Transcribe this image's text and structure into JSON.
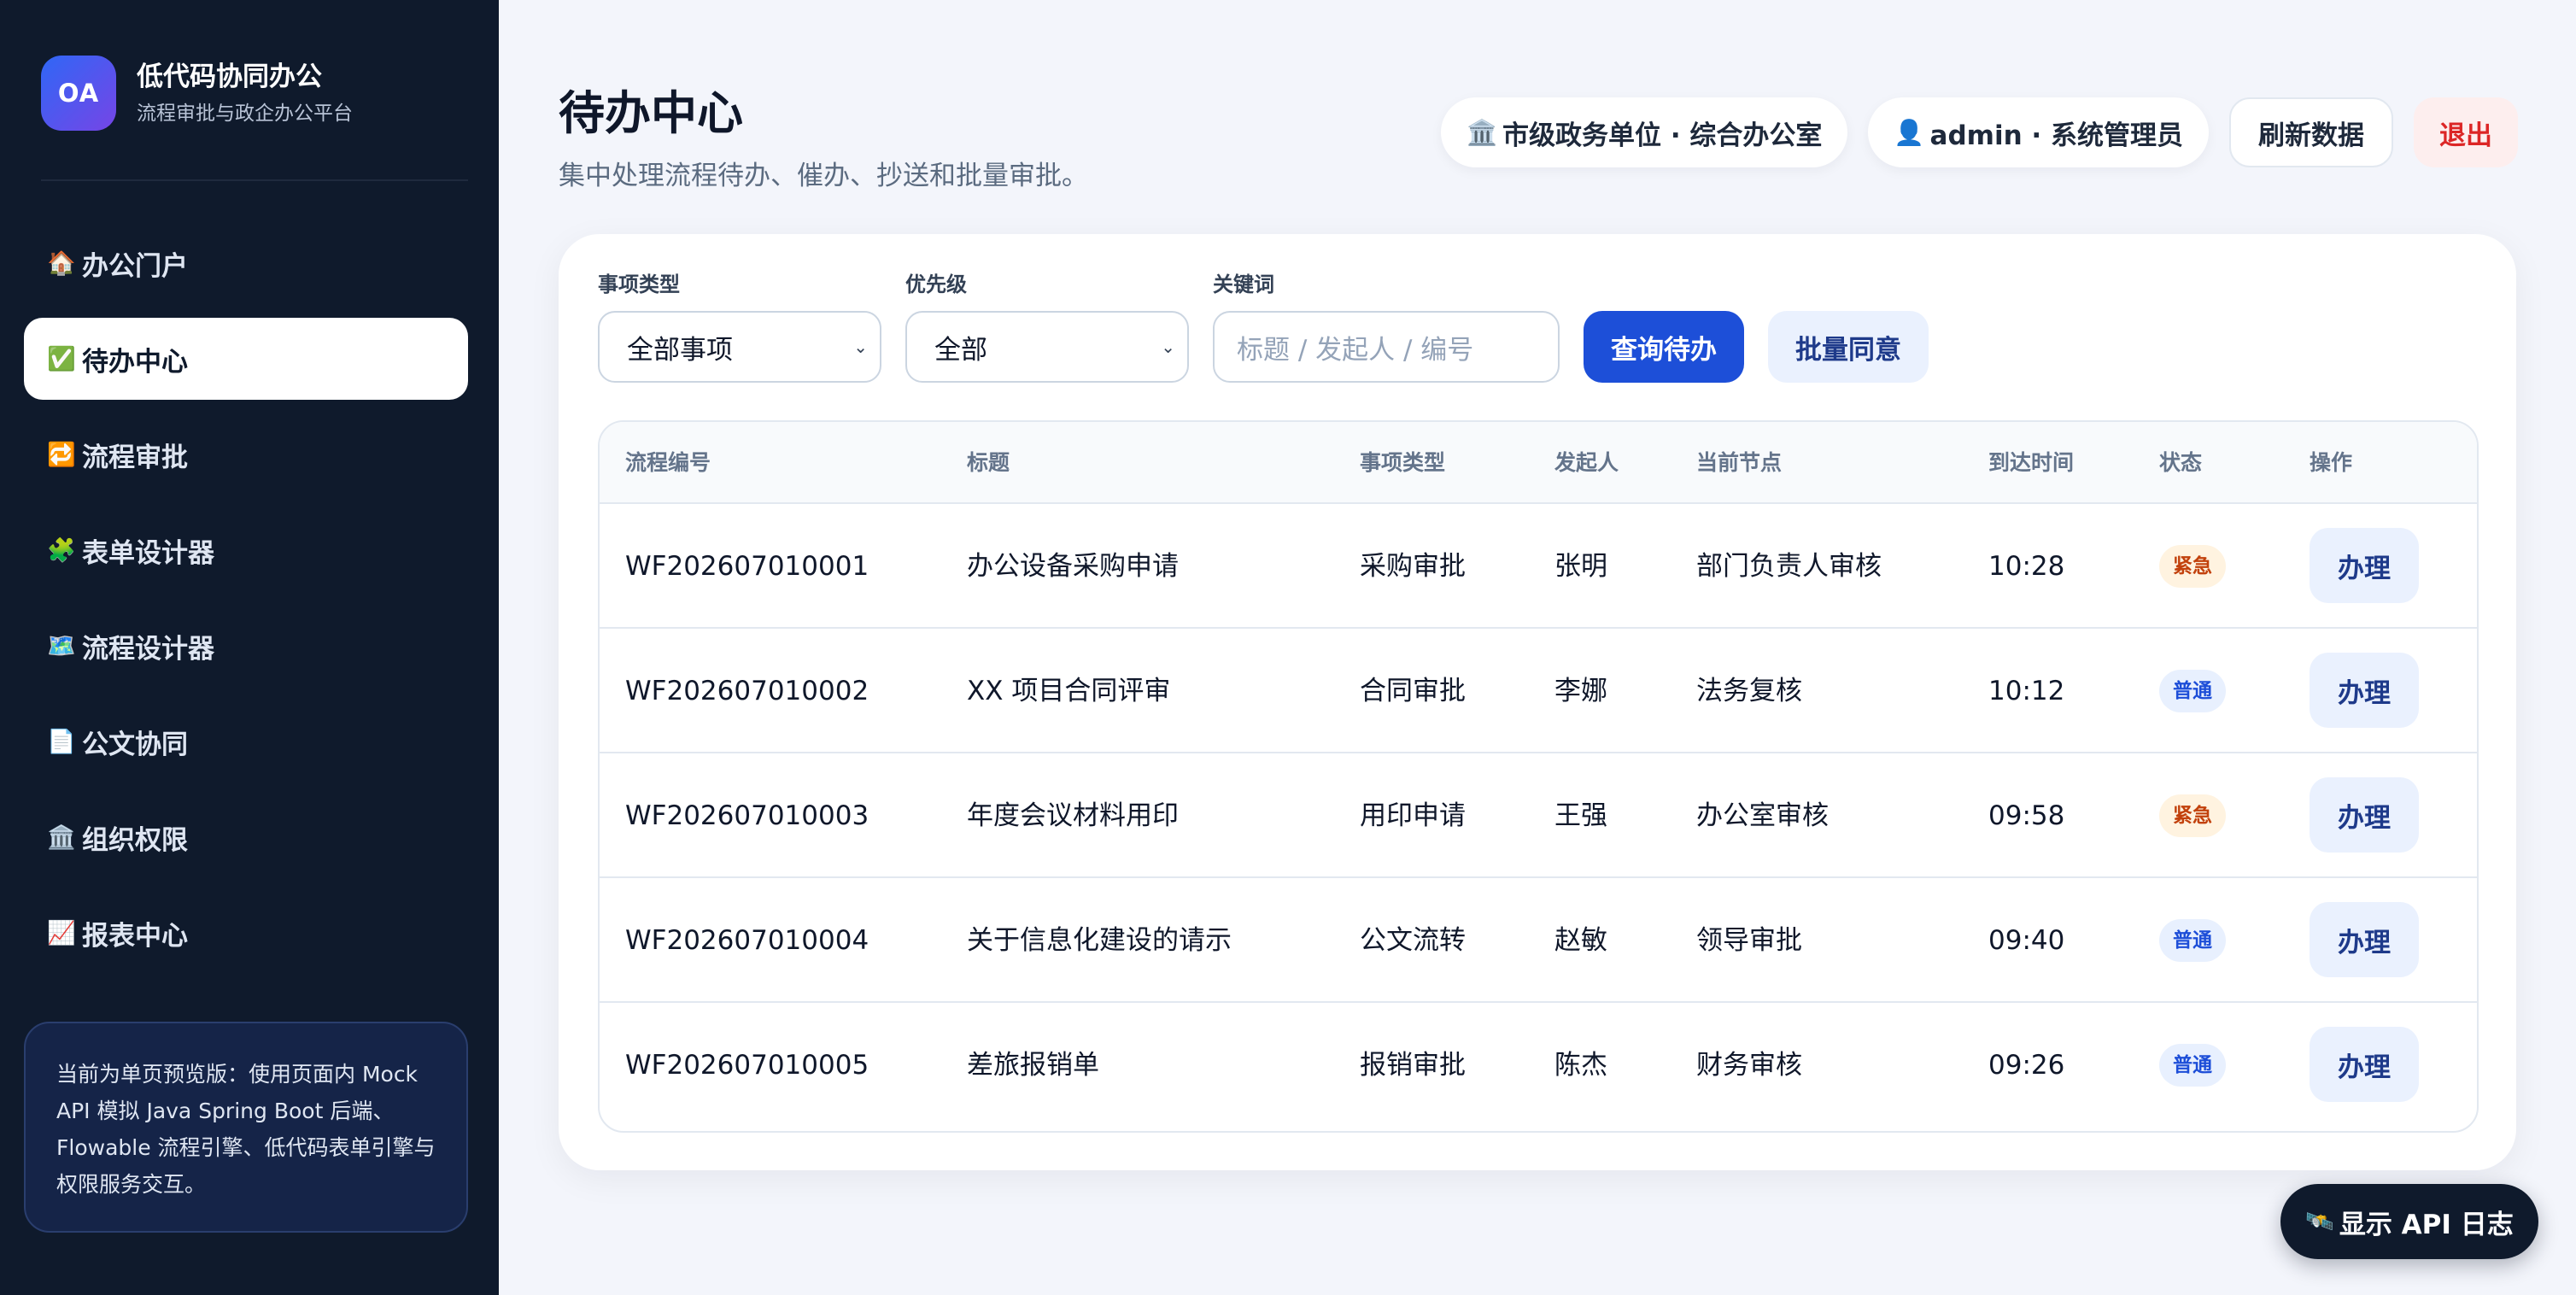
{
  "brand": {
    "logo": "OA",
    "title": "低代码协同办公",
    "subtitle": "流程审批与政企办公平台"
  },
  "nav": [
    {
      "icon": "🏠",
      "icon_name": "home-icon",
      "label": "办公门户",
      "active": false
    },
    {
      "icon": "✅",
      "icon_name": "check-icon",
      "label": "待办中心",
      "active": true
    },
    {
      "icon": "🔁",
      "icon_name": "repeat-icon",
      "label": "流程审批",
      "active": false
    },
    {
      "icon": "🧩",
      "icon_name": "puzzle-icon",
      "label": "表单设计器",
      "active": false
    },
    {
      "icon": "🗺️",
      "icon_name": "map-icon",
      "label": "流程设计器",
      "active": false
    },
    {
      "icon": "📄",
      "icon_name": "document-icon",
      "label": "公文协同",
      "active": false
    },
    {
      "icon": "🏛️",
      "icon_name": "building-icon",
      "label": "组织权限",
      "active": false
    },
    {
      "icon": "📈",
      "icon_name": "chart-icon",
      "label": "报表中心",
      "active": false
    }
  ],
  "notice": "当前为单页预览版：使用页面内 Mock API 模拟 Java Spring Boot 后端、Flowable 流程引擎、低代码表单引擎与权限服务交互。",
  "header": {
    "title": "待办中心",
    "description": "集中处理流程待办、催办、抄送和批量审批。",
    "org_icon": "🏛️",
    "org": "市级政务单位 · 综合办公室",
    "user_icon": "👤",
    "user": "admin · 系统管理员",
    "refresh": "刷新数据",
    "logout": "退出"
  },
  "filters": {
    "type_label": "事项类型",
    "type_value": "全部事项",
    "priority_label": "优先级",
    "priority_value": "全部",
    "keyword_label": "关键词",
    "keyword_placeholder": "标题 / 发起人 / 编号",
    "query_button": "查询待办",
    "batch_button": "批量同意"
  },
  "table": {
    "columns": [
      "流程编号",
      "标题",
      "事项类型",
      "发起人",
      "当前节点",
      "到达时间",
      "状态",
      "操作"
    ],
    "rows": [
      {
        "id": "WF202607010001",
        "title": "办公设备采购申请",
        "type": "采购审批",
        "initiator": "张明",
        "node": "部门负责人审核",
        "time": "10:28",
        "status": "紧急",
        "status_kind": "urgent",
        "action": "办理"
      },
      {
        "id": "WF202607010002",
        "title": "XX 项目合同评审",
        "type": "合同审批",
        "initiator": "李娜",
        "node": "法务复核",
        "time": "10:12",
        "status": "普通",
        "status_kind": "normal",
        "action": "办理"
      },
      {
        "id": "WF202607010003",
        "title": "年度会议材料用印",
        "type": "用印申请",
        "initiator": "王强",
        "node": "办公室审核",
        "time": "09:58",
        "status": "紧急",
        "status_kind": "urgent",
        "action": "办理"
      },
      {
        "id": "WF202607010004",
        "title": "关于信息化建设的请示",
        "type": "公文流转",
        "initiator": "赵敏",
        "node": "领导审批",
        "time": "09:40",
        "status": "普通",
        "status_kind": "normal",
        "action": "办理"
      },
      {
        "id": "WF202607010005",
        "title": "差旅报销单",
        "type": "报销审批",
        "initiator": "陈杰",
        "node": "财务审核",
        "time": "09:26",
        "status": "普通",
        "status_kind": "normal",
        "action": "办理"
      }
    ]
  },
  "api_log": {
    "icon": "🛰️",
    "label": "显示 API 日志"
  },
  "colors": {
    "sidebar": "#0f1a2c",
    "primary": "#1d4fd8",
    "logout": "#dc2626",
    "urgent": "#c2410c",
    "normal": "#1d4ed8"
  }
}
